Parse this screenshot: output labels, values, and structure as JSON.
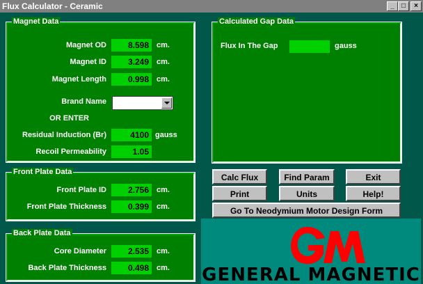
{
  "window": {
    "title": "Flux Calculator - Ceramic"
  },
  "titlebar_buttons": {
    "minimize": "_",
    "maximize": "□",
    "close": "×"
  },
  "magnet": {
    "title": "Magnet Data",
    "od_label": "Magnet OD",
    "od_value": "8.598",
    "od_unit": "cm.",
    "id_label": "Magnet ID",
    "id_value": "3.249",
    "id_unit": "cm.",
    "length_label": "Magnet Length",
    "length_value": "0.998",
    "length_unit": "cm.",
    "brand_label": "Brand Name",
    "brand_value": "",
    "or_enter": "OR ENTER",
    "br_label": "Residual Induction (Br)",
    "br_value": "4100",
    "br_unit": "gauss",
    "recoil_label": "Recoil Permeability",
    "recoil_value": "1.05"
  },
  "front_plate": {
    "title": "Front Plate Data",
    "id_label": "Front Plate ID",
    "id_value": "2.756",
    "id_unit": "cm.",
    "thickness_label": "Front Plate Thickness",
    "thickness_value": "0.399",
    "thickness_unit": "cm."
  },
  "back_plate": {
    "title": "Back Plate Data",
    "core_label": "Core Diameter",
    "core_value": "2.535",
    "core_unit": "cm.",
    "thickness_label": "Back Plate Thickness",
    "thickness_value": "0.498",
    "thickness_unit": "cm."
  },
  "gap": {
    "title": "Calculated Gap Data",
    "flux_label": "Flux In The Gap",
    "flux_value": "",
    "flux_unit": "gauss"
  },
  "buttons": {
    "calc_flux": "Calc Flux",
    "find_param": "Find Param",
    "exit": "Exit",
    "print": "Print",
    "units": "Units",
    "help": "Help!",
    "neodymium": "Go To Neodymium Motor Design Form"
  },
  "logo": {
    "monogram": "GM",
    "text": "GENERAL MAGNETIC"
  },
  "colors": {
    "background": "#00574a",
    "frame": "#008000",
    "field": "#00d000",
    "logo_red": "#ff0000",
    "logo_bg": "#008a7e"
  }
}
